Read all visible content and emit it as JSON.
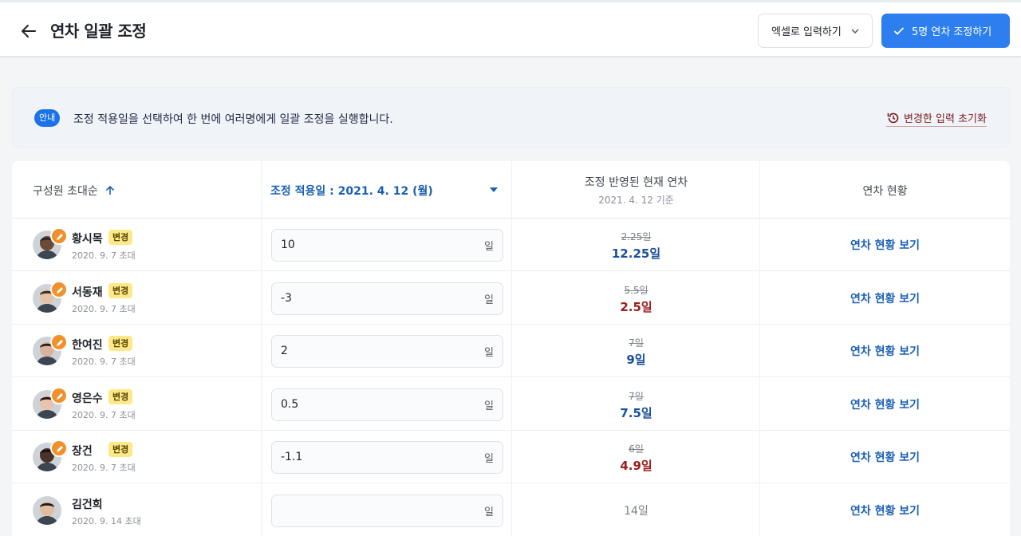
{
  "header": {
    "title": "연차 일괄 조정",
    "excel_label": "엑셀로 입력하기",
    "apply_label": "5명 연차 조정하기"
  },
  "info": {
    "badge": "안내",
    "message": "조정 적용일을 선택하여 한 번에 여러명에게 일괄 조정을 실행합니다.",
    "reset_label": "변경한 입력 초기화"
  },
  "table": {
    "col_name": "구성원 초대순",
    "col_date": "조정 적용일 : 2021. 4. 12 (월)",
    "col_current": "조정 반영된 현재 연차",
    "col_current_sub": "2021. 4. 12 기준",
    "col_status": "연차 현황",
    "unit": "일",
    "link_label": "연차 현황 보기",
    "changed_label": "변경"
  },
  "rows": [
    {
      "name": "황시목",
      "joined": "2020. 9. 7 초대",
      "value": "10",
      "old": "2.25일",
      "new": "12.25일",
      "delta": "up",
      "changed": true
    },
    {
      "name": "서동재",
      "joined": "2020. 9. 7 초대",
      "value": "-3",
      "old": "5.5일",
      "new": "2.5일",
      "delta": "down",
      "changed": true
    },
    {
      "name": "한여진",
      "joined": "2020. 9. 7 초대",
      "value": "2",
      "old": "7일",
      "new": "9일",
      "delta": "up",
      "changed": true
    },
    {
      "name": "영은수",
      "joined": "2020. 9. 7 초대",
      "value": "0.5",
      "old": "7일",
      "new": "7.5일",
      "delta": "up",
      "changed": true
    },
    {
      "name": "장건",
      "joined": "2020. 9. 7 초대",
      "value": "-1.1",
      "old": "6일",
      "new": "4.9일",
      "delta": "down",
      "changed": true
    },
    {
      "name": "김건희",
      "joined": "2020. 9. 14 초대",
      "value": "",
      "old": "",
      "new": "14일",
      "delta": "none",
      "changed": false
    }
  ],
  "colors": {
    "accent": "#2d7ff0",
    "up": "#1a4f9c",
    "down": "#9b1c1c",
    "badge": "#fde98a",
    "edit": "#f0912e"
  }
}
